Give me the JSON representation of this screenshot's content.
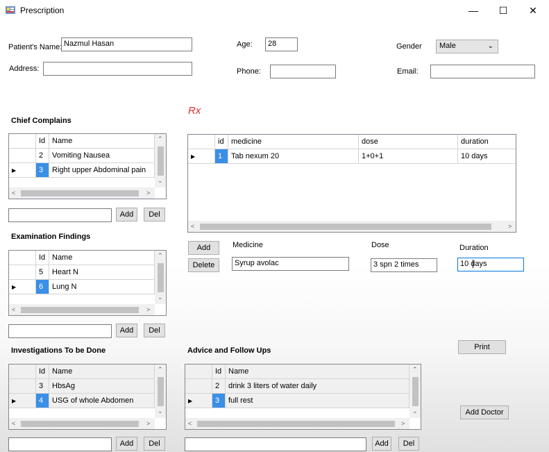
{
  "window": {
    "title": "Prescription",
    "controls": {
      "minimize": "—",
      "maximize": "☐",
      "close": "✕"
    }
  },
  "patient": {
    "name_label": "Patient's Name:",
    "name_value": "Nazmul Hasan",
    "age_label": "Age:",
    "age_value": "28",
    "gender_label": "Gender",
    "gender_value": "Male",
    "address_label": "Address:",
    "address_value": "",
    "phone_label": "Phone:",
    "phone_value": "",
    "email_label": "Email:",
    "email_value": ""
  },
  "rx_label": "Rx",
  "chief": {
    "title": "Chief Complains",
    "columns": [
      "Id",
      "Name"
    ],
    "rows": [
      {
        "id": "2",
        "name": "Vomiting Nausea"
      },
      {
        "id": "3",
        "name": "Right upper Abdominal pain"
      }
    ],
    "add": "Add",
    "del": "Del",
    "input_value": ""
  },
  "exam": {
    "title": "Examination Findings",
    "columns": [
      "Id",
      "Name"
    ],
    "rows": [
      {
        "id": "5",
        "name": "Heart N"
      },
      {
        "id": "6",
        "name": "Lung N"
      }
    ],
    "add": "Add",
    "del": "Del",
    "input_value": ""
  },
  "invest": {
    "title": "Investigations To be Done",
    "columns": [
      "Id",
      "Name"
    ],
    "rows": [
      {
        "id": "3",
        "name": "HbsAg"
      },
      {
        "id": "4",
        "name": "USG of whole Abdomen"
      }
    ],
    "add": "Add",
    "del": "Del",
    "input_value": ""
  },
  "advice": {
    "title": "Advice and Follow Ups",
    "columns": [
      "Id",
      "Name"
    ],
    "rows": [
      {
        "id": "2",
        "name": "drink 3 liters of water daily"
      },
      {
        "id": "3",
        "name": "full rest"
      }
    ],
    "add": "Add",
    "del": "Del",
    "input_value": ""
  },
  "medicine": {
    "columns": [
      "id",
      "medicine",
      "dose",
      "duration"
    ],
    "rows": [
      {
        "id": "1",
        "medicine": "Tab nexum 20",
        "dose": "1+0+1",
        "duration": "10 days"
      }
    ],
    "add": "Add",
    "delete": "Delete",
    "medicine_label": "Medicine",
    "medicine_value": "Syrup avolac",
    "dose_label": "Dose",
    "dose_value": "3 spn 2 times",
    "duration_label": "Duration",
    "duration_value": "10 days"
  },
  "actions": {
    "print": "Print",
    "add_doctor": "Add Doctor"
  },
  "colors": {
    "selection": "#3a8fe6",
    "rx": "#e03030"
  }
}
